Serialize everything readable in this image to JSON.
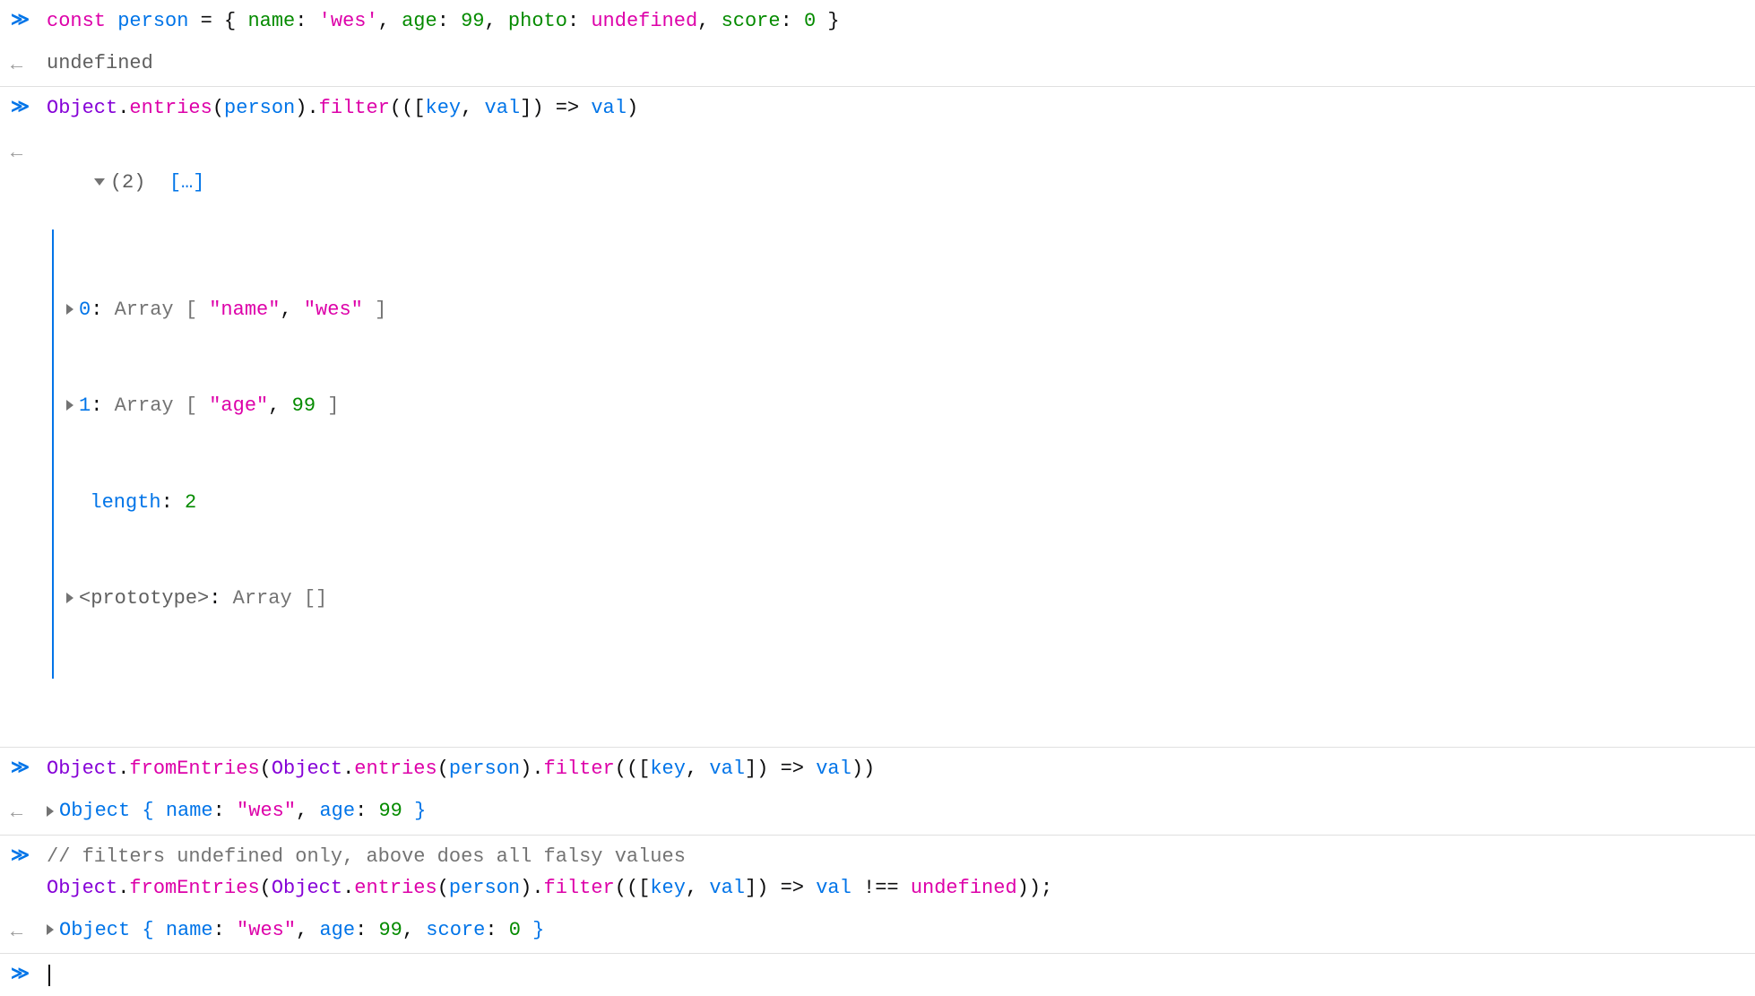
{
  "rows": {
    "r1": {
      "kw_const": "const",
      "var_person": "person",
      "eq": " = ",
      "brace_open": "{ ",
      "k_name": "name",
      "colon1": ": ",
      "v_name": "'wes'",
      "comma1": ", ",
      "k_age": "age",
      "colon2": ": ",
      "v_age": "99",
      "comma2": ", ",
      "k_photo": "photo",
      "colon3": ": ",
      "v_photo": "undefined",
      "comma3": ", ",
      "k_score": "score",
      "colon4": ": ",
      "v_score": "0",
      "brace_close": " }"
    },
    "r2": {
      "undefined": "undefined"
    },
    "r3": {
      "obj": "Object",
      "dot1": ".",
      "entries": "entries",
      "p1": "(",
      "person": "person",
      "p2": ").",
      "filter": "filter",
      "p3": "(([",
      "key": "key",
      "comma": ", ",
      "val": "val",
      "p4": "]) ",
      "arrow": "=>",
      "sp": " ",
      "val2": "val",
      "p5": ")"
    },
    "r4": {
      "count": "(2)",
      "dots": "[…]",
      "line0_idx": "0",
      "line0_colon": ": ",
      "line0_type": "Array [ ",
      "line0_s1": "\"name\"",
      "line0_comma": ", ",
      "line0_s2": "\"wes\"",
      "line0_close": " ]",
      "line1_idx": "1",
      "line1_colon": ": ",
      "line1_type": "Array [ ",
      "line1_s1": "\"age\"",
      "line1_comma": ", ",
      "line1_n": "99",
      "line1_close": " ]",
      "len_k": "length",
      "len_colon": ": ",
      "len_v": "2",
      "proto_k": "<prototype>",
      "proto_colon": ": ",
      "proto_v": "Array []"
    },
    "r5": {
      "obj1": "Object",
      "dot1": ".",
      "from": "fromEntries",
      "p1": "(",
      "obj2": "Object",
      "dot2": ".",
      "entries": "entries",
      "p2": "(",
      "person": "person",
      "p3": ").",
      "filter": "filter",
      "p4": "(([",
      "key": "key",
      "comma": ", ",
      "val": "val",
      "p5": "]) ",
      "arrow": "=>",
      "sp": " ",
      "val2": "val",
      "p6": "))"
    },
    "r6": {
      "obj": "Object ",
      "brace_open": "{ ",
      "k_name": "name",
      "colon1": ": ",
      "v_name": "\"wes\"",
      "comma1": ", ",
      "k_age": "age",
      "colon2": ": ",
      "v_age": "99",
      "brace_close": " }"
    },
    "r7": {
      "comment": "// filters undefined only, above does all falsy values",
      "obj1": "Object",
      "dot1": ".",
      "from": "fromEntries",
      "p1": "(",
      "obj2": "Object",
      "dot2": ".",
      "entries": "entries",
      "p2": "(",
      "person": "person",
      "p3": ").",
      "filter": "filter",
      "p4": "(([",
      "key": "key",
      "comma": ", ",
      "val": "val",
      "p5": "]) ",
      "arrow": "=>",
      "sp": " ",
      "val2": "val",
      "neq": " !== ",
      "undef": "undefined",
      "p6": "));"
    },
    "r8": {
      "obj": "Object ",
      "brace_open": "{ ",
      "k_name": "name",
      "colon1": ": ",
      "v_name": "\"wes\"",
      "comma1": ", ",
      "k_age": "age",
      "colon2": ": ",
      "v_age": "99",
      "comma2": ", ",
      "k_score": "score",
      "colon3": ": ",
      "v_score": "0",
      "brace_close": " }"
    }
  }
}
